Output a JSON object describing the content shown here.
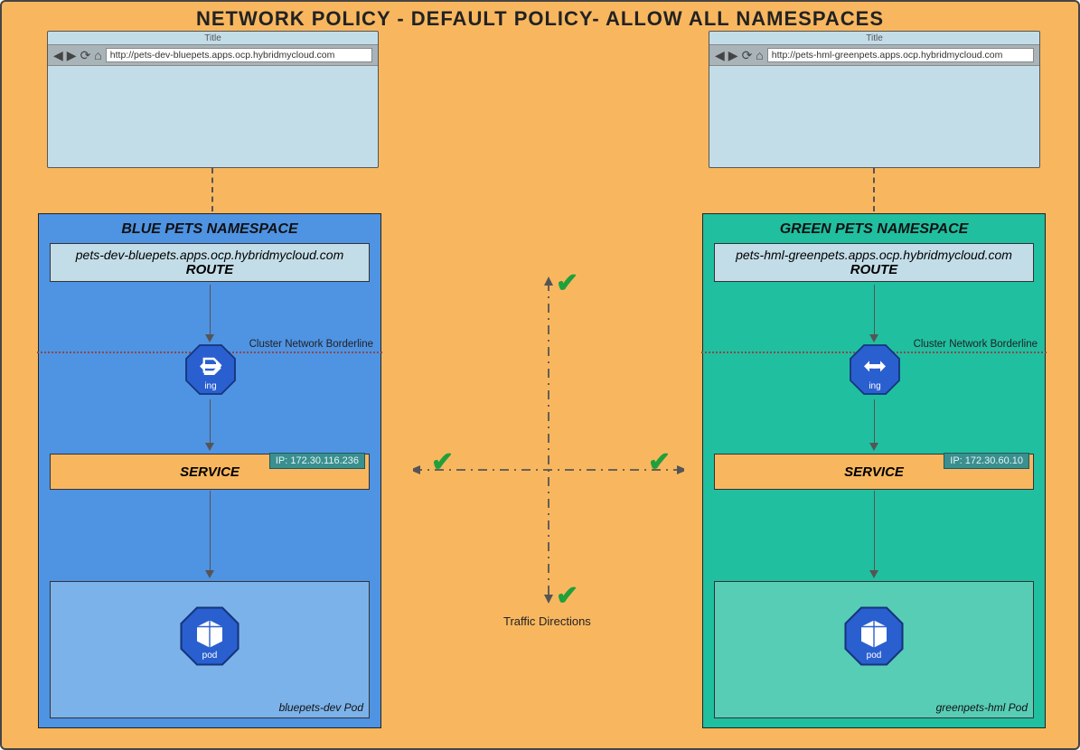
{
  "title": "NETWORK POLICY  - DEFAULT POLICY- ALLOW ALL NAMESPACES",
  "browser": {
    "title_label": "Title",
    "left_url": "http://pets-dev-bluepets.apps.ocp.hybridmycloud.com",
    "right_url": "http://pets-hml-greenpets.apps.ocp.hybridmycloud.com"
  },
  "blue": {
    "ns_title": "BLUE PETS NAMESPACE",
    "route_host": "pets-dev-bluepets.apps.ocp.hybridmycloud.com",
    "route_label": "ROUTE",
    "borderline": "Cluster Network Borderline",
    "ing_label": "ing",
    "service_label": "SERVICE",
    "service_ip": "IP: 172.30.116.236",
    "pod_icon_label": "pod",
    "pod_name": "bluepets-dev Pod"
  },
  "green": {
    "ns_title": "GREEN PETS NAMESPACE",
    "route_host": "pets-hml-greenpets.apps.ocp.hybridmycloud.com",
    "route_label": "ROUTE",
    "borderline": "Cluster Network Borderline",
    "ing_label": "ing",
    "service_label": "SERVICE",
    "service_ip": "IP: 172.30.60.10",
    "pod_icon_label": "pod",
    "pod_name": "greenpets-hml Pod"
  },
  "traffic": {
    "label": "Traffic Directions"
  }
}
